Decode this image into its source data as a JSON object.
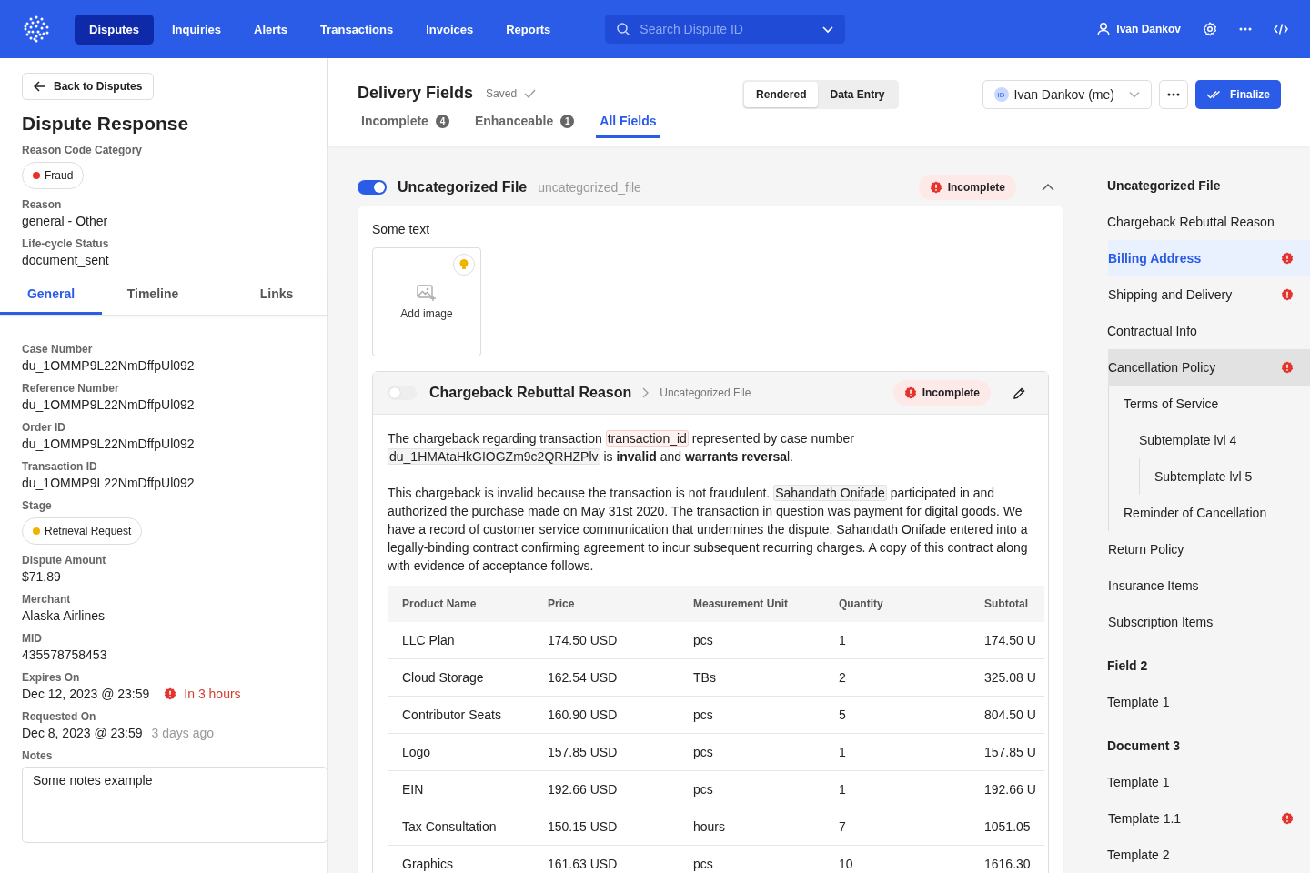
{
  "nav": {
    "items": [
      {
        "label": "Disputes",
        "selected": true
      },
      {
        "label": "Inquiries",
        "selected": false
      },
      {
        "label": "Alerts",
        "selected": false
      },
      {
        "label": "Transactions",
        "selected": false
      },
      {
        "label": "Invoices",
        "selected": false
      },
      {
        "label": "Reports",
        "selected": false
      }
    ],
    "search": {
      "placeholder": "Search Dispute ID"
    },
    "user": "Ivan Dankov"
  },
  "left": {
    "back": "Back to Disputes",
    "title": "Dispute Response",
    "top_fields": [
      {
        "label": "Reason Code Category",
        "value": "Fraud",
        "kind": "pill",
        "color": "#e5322d"
      },
      {
        "label": "Reason",
        "value": "general - Other",
        "kind": "text"
      },
      {
        "label": "Life-cycle Status",
        "value": "document_sent",
        "kind": "text"
      }
    ],
    "tabs": [
      {
        "label": "General",
        "selected": true
      },
      {
        "label": "Timeline",
        "selected": false
      },
      {
        "label": "Links",
        "selected": false
      }
    ],
    "fields": [
      {
        "label": "Case Number",
        "value": "du_1OMMP9L22NmDffpUl092",
        "kind": "text"
      },
      {
        "label": "Reference Number",
        "value": "du_1OMMP9L22NmDffpUl092",
        "kind": "text"
      },
      {
        "label": "Order ID",
        "value": "du_1OMMP9L22NmDffpUl092",
        "kind": "text"
      },
      {
        "label": "Transaction ID",
        "value": "du_1OMMP9L22NmDffpUl092",
        "kind": "text"
      },
      {
        "label": "Stage",
        "value": "Retrieval Request",
        "kind": "pill",
        "color": "#f0b400"
      },
      {
        "label": "Dispute Amount",
        "value": "$71.89",
        "kind": "text"
      },
      {
        "label": "Merchant",
        "value": "Alaska Airlines",
        "kind": "text"
      },
      {
        "label": "MID",
        "value": "435578758453",
        "kind": "text"
      },
      {
        "label": "Expires On",
        "value": "Dec 12, 2023 @ 23:59",
        "kind": "alert",
        "note": "In 3 hours"
      },
      {
        "label": "Requested On",
        "value": "Dec 8, 2023 @ 23:59",
        "kind": "muted",
        "note": "3 days ago"
      }
    ],
    "notes": {
      "label": "Notes",
      "value": "Some notes example"
    }
  },
  "header": {
    "title": "Delivery Fields",
    "status": "Saved",
    "tabs": [
      {
        "label": "Incomplete",
        "count": "4",
        "selected": false
      },
      {
        "label": "Enhanceable",
        "count": "1",
        "selected": false
      },
      {
        "label": "All Fields",
        "selected": true
      }
    ],
    "view": [
      {
        "label": "Rendered",
        "selected": true
      },
      {
        "label": "Data Entry",
        "selected": false
      }
    ],
    "assignee": {
      "initials": "ID",
      "name": "Ivan Dankov (me)"
    },
    "finalize": "Finalize"
  },
  "section": {
    "enabled": true,
    "title": "Uncategorized File",
    "key": "uncategorized_file",
    "status": "Incomplete",
    "intro": "Some text",
    "add_image": "Add image",
    "field": {
      "enabled": false,
      "title": "Chargeback Rebuttal Reason",
      "crumb": "Uncategorized File",
      "status": "Incomplete",
      "paragraphs": [
        [
          {
            "kind": "plain",
            "text": "The chargeback regarding transaction "
          },
          {
            "kind": "variable",
            "text": "transaction_id"
          },
          {
            "kind": "plain",
            "text": " represented by case number "
          },
          {
            "kind": "value",
            "text": "du_1HMAtaHkGIOGZm9c2QRHZPlv"
          },
          {
            "kind": "plain",
            "text": " is **invalid** and **warrants reversa**l."
          }
        ],
        [
          {
            "kind": "plain",
            "text": "This chargeback is invalid because the transaction is not fraudulent. "
          },
          {
            "kind": "value",
            "text": "Sahandath Onifade"
          },
          {
            "kind": "plain",
            "text": " participated in and authorized the purchase made on May 31st 2020. The transaction in question was payment for digital goods. We have a record of customer service communication that undermines the dispute. Sahandath Onifade entered into a legally-binding contract confirming agreement to incur subsequent recurring charges. A copy of this contract along with evidence of acceptance follows."
          }
        ]
      ],
      "table": {
        "columns": [
          "Product Name",
          "Price",
          "Measurement Unit",
          "Quantity",
          "Subtotal"
        ],
        "rows": [
          [
            "LLC Plan",
            "174.50 USD",
            "pcs",
            "1",
            "174.50 U"
          ],
          [
            "Cloud Storage",
            "162.54 USD",
            "TBs",
            "2",
            "325.08 U"
          ],
          [
            "Contributor Seats",
            "160.90 USD",
            "pcs",
            "5",
            "804.50 U"
          ],
          [
            "Logo",
            "157.85 USD",
            "pcs",
            "1",
            "157.85 U"
          ],
          [
            "EIN",
            "192.66 USD",
            "pcs",
            "1",
            "192.66 U"
          ],
          [
            "Tax Consultation",
            "150.15 USD",
            "hours",
            "7",
            "1051.05"
          ],
          [
            "Graphics",
            "161.63 USD",
            "pcs",
            "10",
            "1616.30"
          ]
        ]
      }
    }
  },
  "outline": {
    "sections": [
      {
        "title": "Uncategorized File",
        "items": [
          {
            "label": "Chargeback Rebuttal Reason",
            "selected": false,
            "error": false,
            "hovered": false,
            "children": [
              {
                "label": "Billing Address",
                "selected": true,
                "error": true,
                "hovered": false
              },
              {
                "label": "Shipping and Delivery",
                "selected": false,
                "error": true,
                "hovered": false
              }
            ]
          },
          {
            "label": "Contractual Info",
            "selected": false,
            "error": false,
            "hovered": false,
            "children": [
              {
                "label": "Cancellation Policy",
                "selected": false,
                "error": true,
                "hovered": true,
                "children": [
                  {
                    "label": "Terms of Service",
                    "selected": false,
                    "error": false,
                    "hovered": false,
                    "children": [
                      {
                        "label": "Subtemplate lvl 4",
                        "selected": false,
                        "error": false,
                        "hovered": false,
                        "children": [
                          {
                            "label": "Subtemplate lvl 5",
                            "selected": false,
                            "error": false,
                            "hovered": false
                          }
                        ]
                      }
                    ]
                  },
                  {
                    "label": "Reminder of Cancellation",
                    "selected": false,
                    "error": false,
                    "hovered": false
                  }
                ]
              },
              {
                "label": "Return Policy",
                "selected": false,
                "error": false,
                "hovered": false
              },
              {
                "label": "Insurance Items",
                "selected": false,
                "error": false,
                "hovered": false
              },
              {
                "label": "Subscription Items",
                "selected": false,
                "error": false,
                "hovered": false
              }
            ]
          }
        ]
      },
      {
        "title": "Field 2",
        "items": [
          {
            "label": "Template 1",
            "selected": false,
            "error": false,
            "hovered": false
          }
        ]
      },
      {
        "title": "Document 3",
        "items": [
          {
            "label": "Template 1",
            "selected": false,
            "error": false,
            "hovered": false,
            "children": [
              {
                "label": "Template 1.1",
                "selected": false,
                "error": true,
                "hovered": false
              }
            ]
          },
          {
            "label": "Template 2",
            "selected": false,
            "error": false,
            "hovered": false
          }
        ]
      }
    ]
  }
}
